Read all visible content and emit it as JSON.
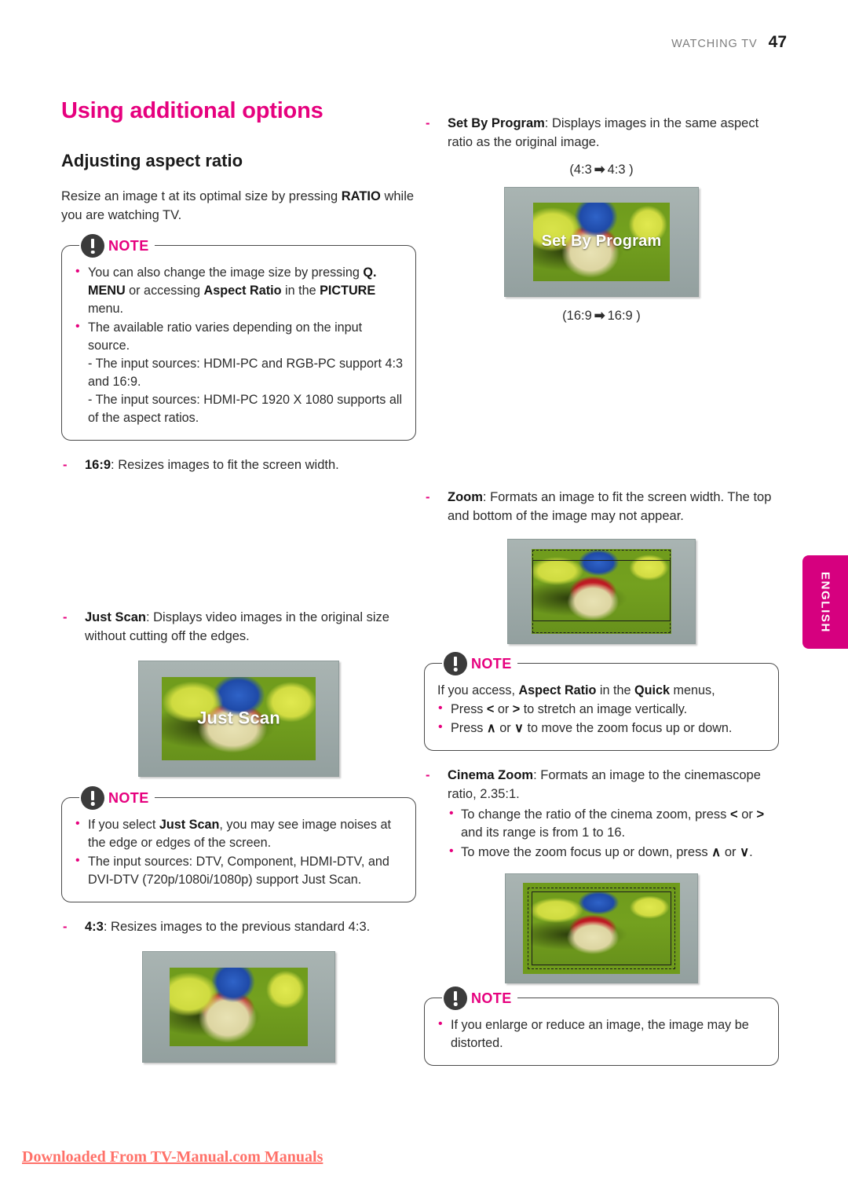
{
  "header": {
    "section_label": "WATCHING TV",
    "page_number": "47"
  },
  "language_tab": {
    "label": "ENGLISH",
    "color": "#d6007f"
  },
  "watermark": {
    "text": "Downloaded From TV-Manual.com Manuals",
    "color": "#ff3b30"
  },
  "accent_color": "#e6007e",
  "left_column": {
    "title": "Using additional options",
    "subtitle": "Adjusting aspect ratio",
    "intro": {
      "part1": "Resize an image t at its optimal size by pressing ",
      "bold1": "RATIO",
      "part2": " while you are watching TV."
    },
    "note1": {
      "word": "NOTE",
      "bullet1": {
        "t1": "You can also change the image size by pressing ",
        "b1": "Q. MENU",
        "t2": " or accessing ",
        "b2": "Aspect Ratio",
        "t3": " in the ",
        "b3": "PICTURE",
        "t4": " menu."
      },
      "bullet2": {
        "t1": "The available ratio varies depending on the input source.",
        "sub1": "- The input sources: HDMI-PC and RGB-PC support 4:3 and 16:9.",
        "sub2": "- The input sources: HDMI-PC 1920 X 1080 supports all of the aspect ratios."
      }
    },
    "item_169": {
      "dash": "-",
      "bold": "16:9",
      "text": ": Resizes images to fit the screen width."
    },
    "item_justscan": {
      "dash": "-",
      "bold": "Just Scan",
      "text": ": Displays video images in the original size without cutting off the edges.",
      "screen_caption": "Just Scan"
    },
    "note2": {
      "word": "NOTE",
      "bullet1": {
        "t1": "If you select ",
        "b1": "Just Scan",
        "t2": ", you may see image noises at the edge or edges of the screen."
      },
      "bullet2": {
        "t1": "The input sources: DTV, Component, HDMI-DTV, and DVI-DTV (720p/1080i/1080p) support Just Scan."
      }
    },
    "item_43": {
      "dash": "-",
      "bold": "4:3",
      "text": ": Resizes images to the previous standard 4:3."
    }
  },
  "right_column": {
    "item_setbyprogram": {
      "dash": "-",
      "bold": "Set By Program",
      "text": ": Displays images in the same aspect ratio as the original image.",
      "caption_above": "(4:3 ➡ 4:3 )",
      "caption_above_left": "(4:3",
      "caption_above_right": "4:3 )",
      "screen_caption": "Set By Program",
      "caption_below_left": "(16:9",
      "caption_below_right": "16:9 )",
      "arrow": "➡"
    },
    "item_zoom": {
      "dash": "-",
      "bold": "Zoom",
      "text": ": Formats an image to fit the screen width. The top and bottom of the image may not appear."
    },
    "note3": {
      "word": "NOTE",
      "lead": {
        "t1": "If you access, ",
        "b1": "Aspect Ratio",
        "t2": " in the ",
        "b2": "Quick",
        "t3": " menus,"
      },
      "bullet1": {
        "t1": "Press ",
        "k1": "<",
        "t2": " or ",
        "k2": ">",
        "t3": " to stretch an image vertically."
      },
      "bullet2": {
        "t1": "Press ",
        "k1": "∧",
        "t2": " or ",
        "k2": "∨",
        "t3": " to move the zoom focus up or down."
      }
    },
    "item_cinemazoom": {
      "dash": "-",
      "bold": "Cinema Zoom",
      "text": ": Formats an image to the cinemascope ratio, 2.35:1.",
      "bullet1": {
        "t1": "To change the ratio of the cinema zoom, press ",
        "k1": "<",
        "t2": " or ",
        "k2": ">",
        "t3": " and its range is from 1 to 16."
      },
      "bullet2": {
        "t1": "To move the zoom focus up or down, press ",
        "k1": "∧",
        "t2": " or ",
        "k2": "∨",
        "t3": "."
      }
    },
    "note4": {
      "word": "NOTE",
      "bullet1": {
        "t1": "If you enlarge or reduce an image, the image may be distorted."
      }
    }
  }
}
